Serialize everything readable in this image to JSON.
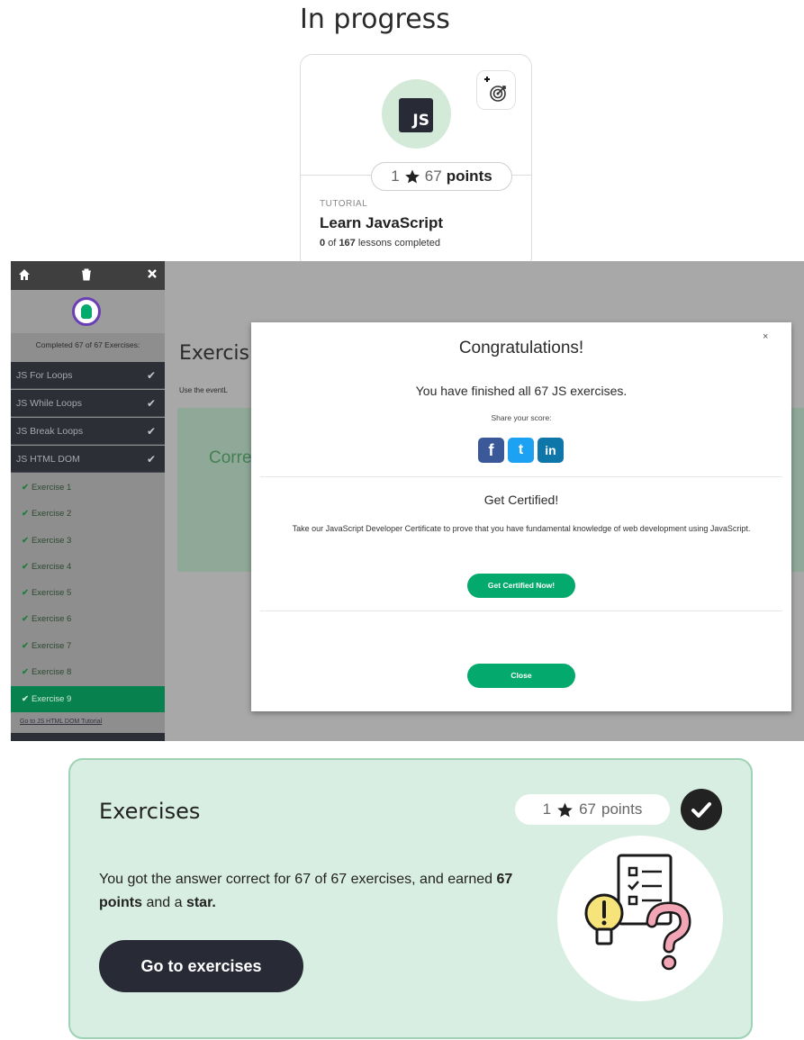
{
  "in_progress": {
    "section_title": "In progress",
    "card": {
      "logo_text": "JS",
      "stars": "1",
      "points_value": "67",
      "points_label": "points",
      "kind": "TUTORIAL",
      "name": "Learn JavaScript",
      "lessons_done": "0",
      "lessons_of": "of",
      "lessons_total": "167",
      "lessons_suffix": "lessons completed"
    }
  },
  "exercise_app": {
    "sidebar": {
      "completed_text": "Completed 67 of 67 Exercises:",
      "topics": [
        {
          "label": "JS For Loops"
        },
        {
          "label": "JS While Loops"
        },
        {
          "label": "JS Break Loops"
        },
        {
          "label": "JS HTML DOM"
        }
      ],
      "exercises": [
        {
          "label": "Exercise 1"
        },
        {
          "label": "Exercise 2"
        },
        {
          "label": "Exercise 3"
        },
        {
          "label": "Exercise 4"
        },
        {
          "label": "Exercise 5"
        },
        {
          "label": "Exercise 6"
        },
        {
          "label": "Exercise 7"
        },
        {
          "label": "Exercise 8"
        },
        {
          "label": "Exercise 9"
        }
      ],
      "tutorial_link": "Go to JS HTML DOM Tutorial"
    },
    "background": {
      "heading": "Exercis",
      "subtext": "Use the  eventL",
      "correct_text": "Corre"
    },
    "modal": {
      "close_x": "×",
      "title": "Congratulations!",
      "finished_text": "You have finished all 67 JS exercises.",
      "share_text": "Share your score:",
      "social": [
        {
          "label": "f",
          "color": "#3b5998"
        },
        {
          "label": "t",
          "color": "#1da1f2"
        },
        {
          "label": "in",
          "color": "#0e76a8"
        }
      ],
      "cert_title": "Get Certified!",
      "cert_text": "Take our JavaScript Developer Certificate to prove that you have fundamental knowledge of web development using JavaScript.",
      "cert_button": "Get Certified Now!",
      "close_button": "Close"
    }
  },
  "exercises_card": {
    "title": "Exercises",
    "stars": "1",
    "points_value": "67",
    "points_label": "points",
    "text_part1": "You got the answer correct for 67 of 67 exercises, and earned ",
    "text_bold1": "67 points",
    "text_part2": " and a ",
    "text_bold2": "star.",
    "button": "Go to exercises"
  },
  "colors": {
    "accent_green": "#04aa6d",
    "dark": "#282a35",
    "mint_bg": "#d9eee2"
  }
}
